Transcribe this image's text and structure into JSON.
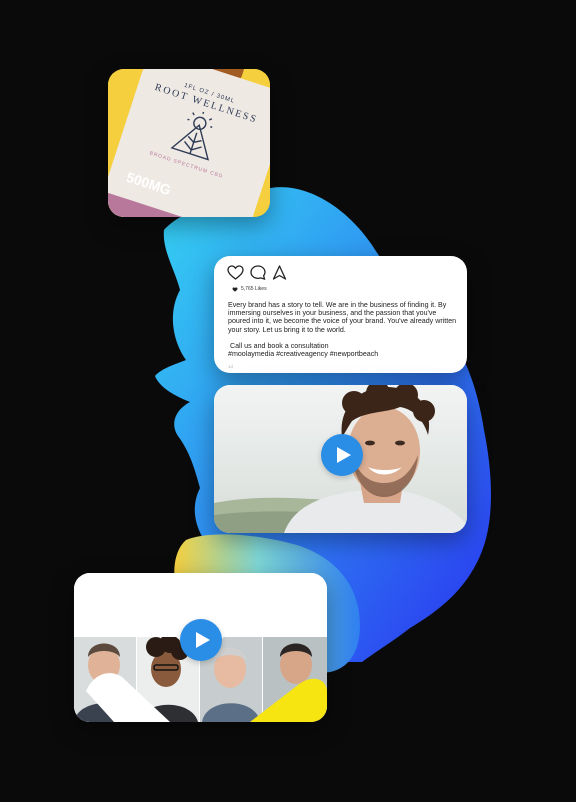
{
  "product": {
    "brand": "ROOT WELLNESS",
    "volume": "1FL OZ / 30ML",
    "dose": "500MG",
    "spectrum": "BROAD SPECTRUM CBD"
  },
  "post": {
    "likes": "5,765 Likes",
    "caption": "Every brand has a story to tell. We are in the business of finding it. By immersing ourselves in your business, and the passion that you've poured into it, we become the voice of your brand. You've already written your story. Let us bring it to the world.\n\n Call us and book a consultation\n#moolaymedia #creativeagency #newportbeach",
    "time": "1d"
  },
  "colors": {
    "background": "#0b0a0b",
    "play_button": "#2a8ee6",
    "accent_yellow": "#f5cf3e"
  },
  "icons": [
    "heart-icon",
    "comment-icon",
    "share-icon",
    "play-icon"
  ]
}
